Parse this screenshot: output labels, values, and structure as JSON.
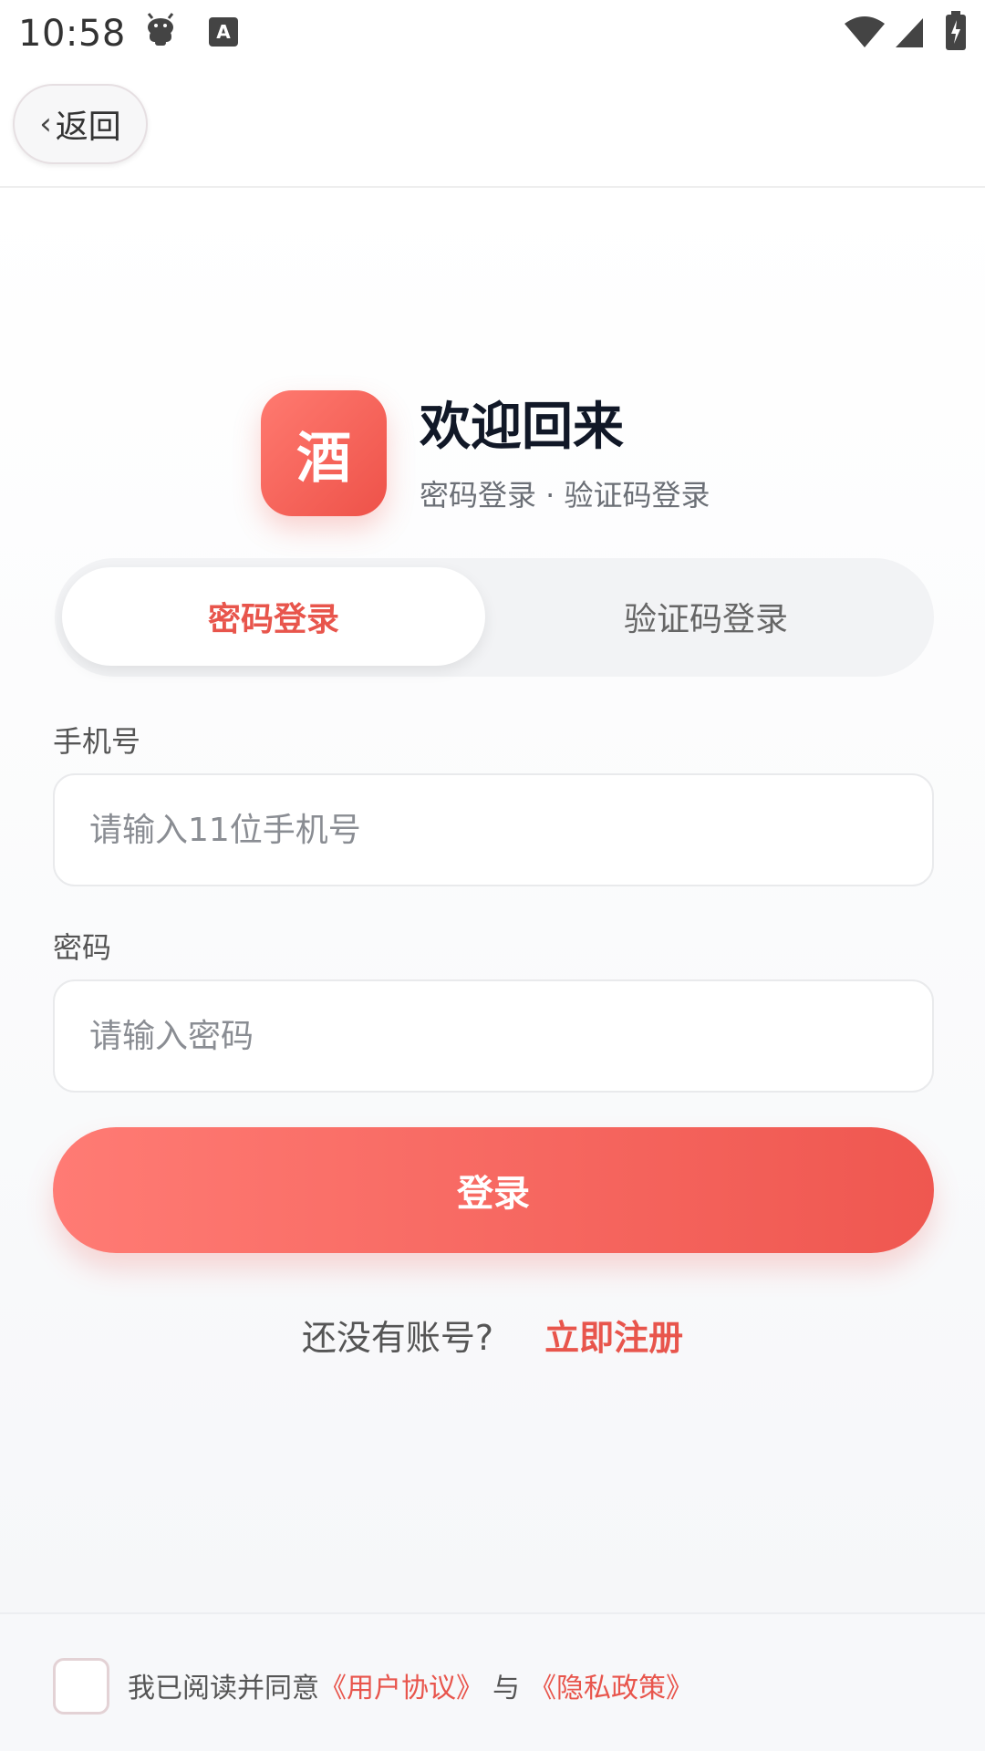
{
  "status_bar": {
    "time": "10:58",
    "icons": [
      "android-debug-icon",
      "keyboard-a-icon",
      "wifi-icon",
      "cell-signal-icon",
      "battery-charging-icon"
    ]
  },
  "nav": {
    "back_label": "返回"
  },
  "brand": {
    "logo_text": "酒",
    "title": "欢迎回来",
    "subtitle": "密码登录 · 验证码登录"
  },
  "tabs": [
    {
      "label": "密码登录",
      "active": true
    },
    {
      "label": "验证码登录",
      "active": false
    }
  ],
  "form": {
    "phone": {
      "label": "手机号",
      "placeholder": "请输入11位手机号",
      "value": ""
    },
    "password": {
      "label": "密码",
      "placeholder": "请输入密码",
      "value": ""
    }
  },
  "login_button": "登录",
  "register": {
    "question": "还没有账号?",
    "link": "立即注册"
  },
  "agreement": {
    "checked": false,
    "prefix": "我已阅读并同意",
    "user_agreement": "《用户协议》",
    "and": "与",
    "privacy_policy": "《隐私政策》"
  },
  "colors": {
    "accent": "#e8554c",
    "button_gradient_start": "#ff7b74",
    "button_gradient_end": "#ef5750"
  }
}
